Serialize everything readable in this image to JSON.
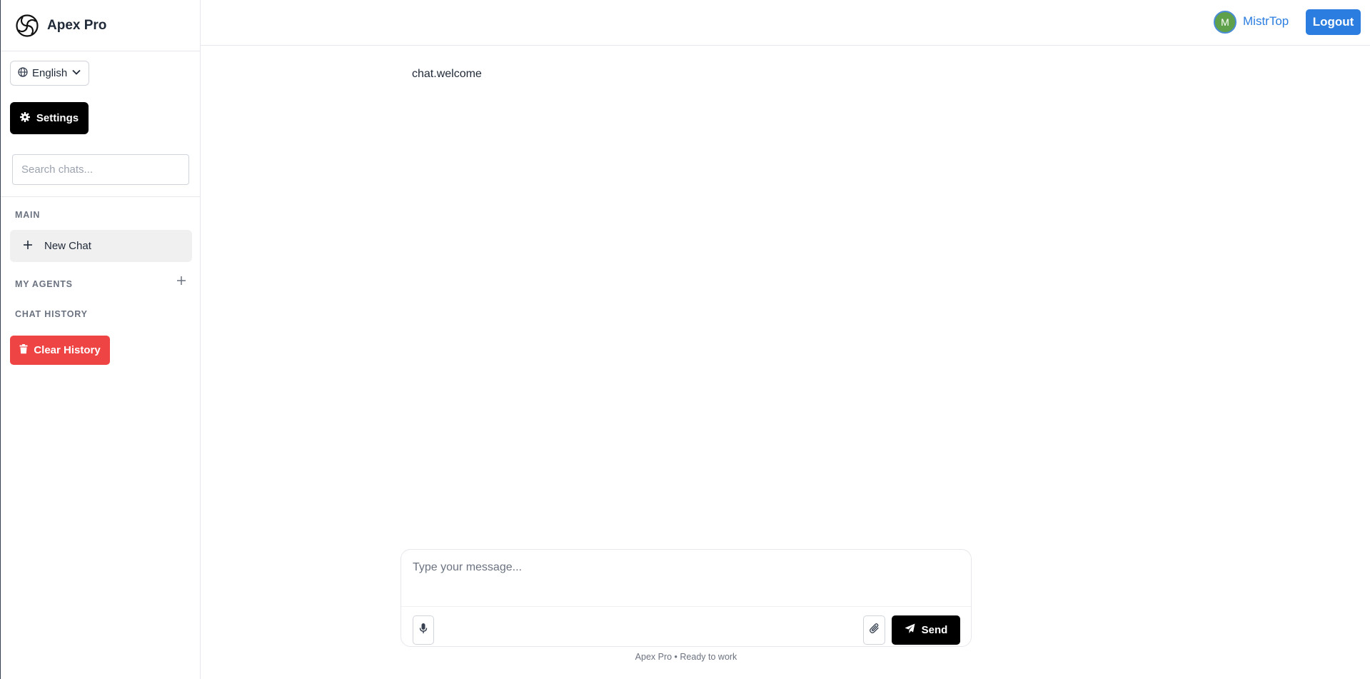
{
  "sidebar": {
    "brand": {
      "name": "Apex Pro",
      "logo_icon": "swirl-logo-icon"
    },
    "language": {
      "selected": "English",
      "icon": "globe-icon"
    },
    "settings_label": "Settings",
    "search": {
      "placeholder": "Search chats...",
      "value": ""
    },
    "sections": {
      "main": "MAIN",
      "my_agents": "MY AGENTS",
      "chat_history": "CHAT HISTORY"
    },
    "new_chat_label": "New Chat",
    "clear_history_label": "Clear History"
  },
  "header": {
    "avatar_initial": "M",
    "username": "MistrTop",
    "logout_label": "Logout"
  },
  "main": {
    "welcome_text": "chat.welcome",
    "composer": {
      "placeholder": "Type your message...",
      "value": "",
      "send_label": "Send"
    },
    "status_text": "Apex Pro • Ready to work"
  },
  "colors": {
    "accent_blue": "#2b7de0",
    "danger_red": "#ef4444",
    "primary_black": "#000000",
    "avatar_green": "#5fa14a"
  }
}
